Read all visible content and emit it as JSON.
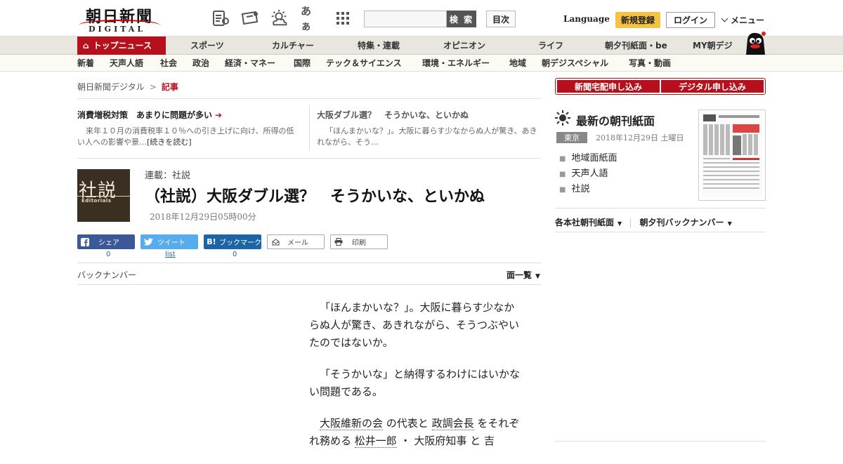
{
  "header": {
    "logo_jp": "朝日新聞",
    "logo_en": "DIGITAL",
    "search_label": "検 索",
    "index_label": "目次",
    "language": "Language",
    "register": "新規登録",
    "login": "ログイン",
    "menu": "メニュー",
    "font_size_icon_text": "あぁ"
  },
  "nav1": [
    "トップニュース",
    "スポーツ",
    "カルチャー",
    "特集・連載",
    "オピニオン",
    "ライフ",
    "朝夕刊紙面・be",
    "MY朝デジ"
  ],
  "nav2": [
    "新着",
    "天声人語",
    "社会",
    "政治",
    "経済・マネー",
    "国際",
    "テック＆サイエンス",
    "環境・エネルギー",
    "地域",
    "朝デジスペシャル",
    "写真・動画"
  ],
  "breadcrumb": {
    "home": "朝日新聞デジタル",
    "sep": ">",
    "current": "記事"
  },
  "related": [
    {
      "title": "消費増税対策　あまりに問題が多い",
      "desc": "来年１０月の消費税率１０％への引き上げに向け、所得の低い人への影響や景…",
      "more": "[続きを読む]"
    },
    {
      "title": "大阪ダブル選？　そうかいな、といかぬ",
      "desc": "「ほんまかいな？」。大阪に暮らす少なからぬ人が驚き、あきれながら、そう…"
    }
  ],
  "article": {
    "editorial_kanji": "社説",
    "editorial_en": "Editorials",
    "series": "連載：社説",
    "title": "（社説）大阪ダブル選？　そうかいな、といかぬ",
    "date": "2018年12月29日05時00分"
  },
  "share": {
    "facebook": "シェア",
    "facebook_count": "0",
    "twitter": "ツイート",
    "twitter_count": "list",
    "hatena": "ブックマーク",
    "hatena_count": "0",
    "mail": "メール",
    "print": "印刷"
  },
  "backnumber": "バックナンバー",
  "menu_list": "面一覧",
  "body": {
    "p1": "「ほんまかいな？」。大阪に暮らす少なからぬ人が驚き、あきれながら、そうつぶやいたのではないか。",
    "p2": "「そうかいな」と納得するわけにはいかない問題である。",
    "p3_link1": "大阪維新の会",
    "p3_mid": " の代表と ",
    "p3_link2": "政調会長",
    "p3_mid2": " をそれぞれ務める ",
    "p3_link3": "松井一郎",
    "p3_mid3": " ・ 大阪府知事 と 吉"
  },
  "right": {
    "btn1": "新聞宅配申し込み",
    "btn2": "デジタル申し込み",
    "paper_title": "最新の朝刊紙面",
    "region": "東京",
    "paper_date": "2018年12月29日 土曜日",
    "paper_items": [
      "地域面紙面",
      "天声人語",
      "社説"
    ],
    "link1": "各本社朝刊紙面",
    "link2": "朝夕刊バックナンバー"
  }
}
